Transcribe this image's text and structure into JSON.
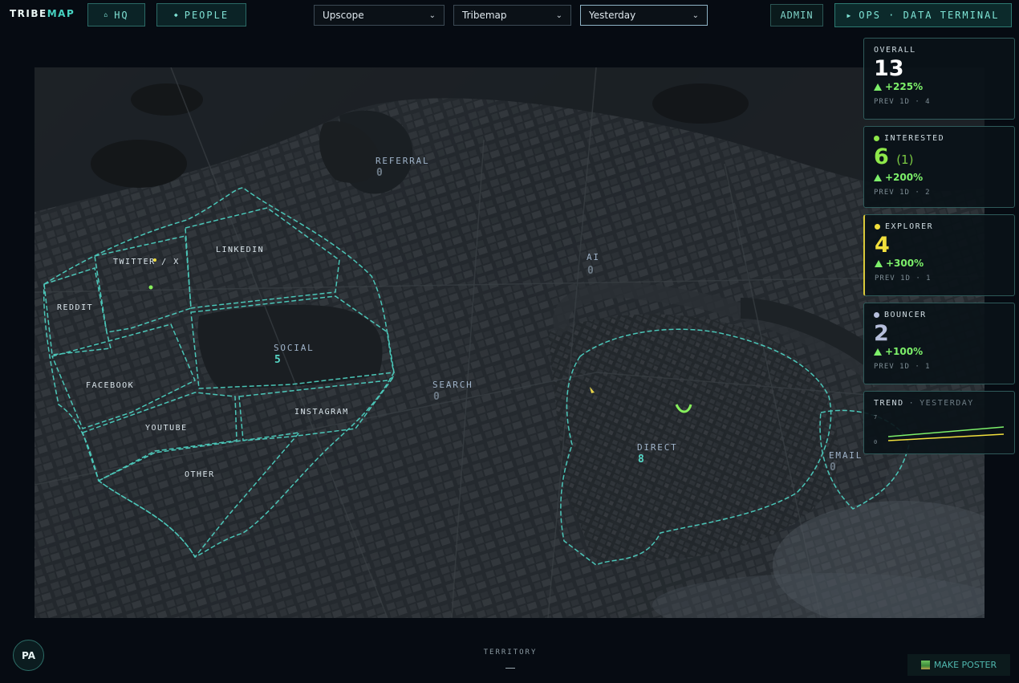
{
  "app": {
    "logo_main": "TRIBE",
    "logo_accent": "MAP"
  },
  "nav": {
    "hq_label": "HQ",
    "people_label": "PEOPLE",
    "admin_label": "ADMIN",
    "ops_label": "OPS · DATA TERMINAL"
  },
  "filters": {
    "workspace": "Upscope",
    "project": "Tribemap",
    "period": "Yesterday"
  },
  "zones": {
    "twitter": {
      "label": "TWITTER / X"
    },
    "linkedin": {
      "label": "LINKEDIN"
    },
    "reddit": {
      "label": "REDDIT"
    },
    "facebook": {
      "label": "FACEBOOK"
    },
    "youtube": {
      "label": "YOUTUBE"
    },
    "other": {
      "label": "OTHER"
    },
    "instagram": {
      "label": "INSTAGRAM"
    },
    "social": {
      "label": "SOCIAL",
      "count": "5"
    },
    "referral": {
      "label": "REFERRAL",
      "count": "0"
    },
    "ai": {
      "label": "AI",
      "count": "0"
    },
    "search": {
      "label": "SEARCH",
      "count": "0"
    },
    "direct": {
      "label": "DIRECT",
      "count": "8"
    },
    "email": {
      "label": "EMAIL",
      "count": "0"
    }
  },
  "stats": {
    "overall": {
      "label": "OVERALL",
      "value": "13",
      "delta": "+225%",
      "prev": "PREV 1D · 4"
    },
    "interested": {
      "label": "INTERESTED",
      "value": "6",
      "extra": "(1)",
      "delta": "+200%",
      "prev": "PREV 1D · 2",
      "color": "#8ee84a"
    },
    "explorer": {
      "label": "EXPLORER",
      "value": "4",
      "delta": "+300%",
      "prev": "PREV 1D · 1",
      "color": "#f2e03c"
    },
    "bouncer": {
      "label": "BOUNCER",
      "value": "2",
      "delta": "+100%",
      "prev": "PREV 1D · 1",
      "color": "#b6bfdc"
    }
  },
  "trend": {
    "label": "TREND",
    "period": "YESTERDAY",
    "ymax": "7",
    "ymin": "0"
  },
  "footer": {
    "avatar_initials": "PA",
    "territory_label": "TERRITORY",
    "poster_label": "MAKE POSTER"
  },
  "colors": {
    "accent": "#47d3c2",
    "zone_outline": "#4fd6c6",
    "delta": "#7df06a"
  }
}
